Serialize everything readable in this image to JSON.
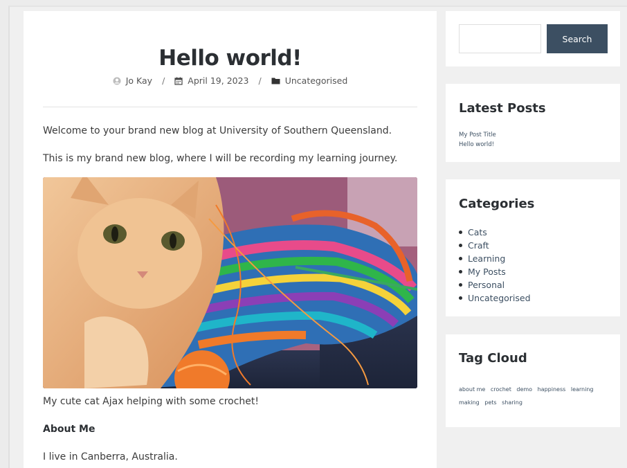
{
  "post": {
    "title": "Hello world!",
    "meta": {
      "author": "Jo Kay",
      "separator": "/",
      "date": "April 19, 2023",
      "category": "Uncategorised"
    },
    "paragraph1": "Welcome to your brand new blog at University of Southern Queensland.",
    "paragraph2": "This is my brand new blog, where I will be recording my learning journey.",
    "caption": "My cute cat Ajax helping with some crochet!",
    "about_heading": "About Me",
    "about_text": "I live in Canberra, Australia."
  },
  "sidebar": {
    "search": {
      "value": "",
      "placeholder": "",
      "button_label": "Search"
    },
    "latest_posts": {
      "title": "Latest Posts",
      "items": [
        "My Post Title",
        "Hello world!"
      ]
    },
    "categories": {
      "title": "Categories",
      "items": [
        "Cats",
        "Craft",
        "Learning",
        "My Posts",
        "Personal",
        "Uncategorised"
      ]
    },
    "tag_cloud": {
      "title": "Tag Cloud",
      "tags": [
        "about me",
        "crochet",
        "demo",
        "happiness",
        "learning",
        "making",
        "pets",
        "sharing"
      ]
    }
  },
  "icons": {
    "author": "user-avatar-icon",
    "date": "calendar-icon",
    "category": "folder-icon"
  },
  "colors": {
    "accent": "#3c4f62",
    "page_background": "#f0f0f0",
    "card_background": "#ffffff",
    "heading": "#2b2f33"
  }
}
